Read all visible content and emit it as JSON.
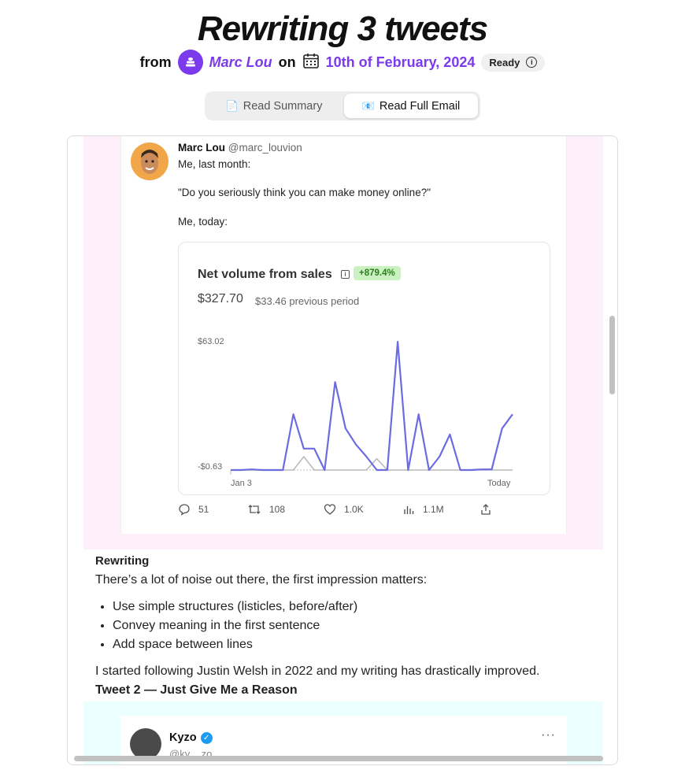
{
  "header": {
    "title": "Rewriting 3 tweets",
    "from_label": "from",
    "author": "Marc Lou",
    "on_label": "on",
    "date": "10th of February, 2024",
    "status": "Ready"
  },
  "tabs": [
    {
      "label": "Read Summary",
      "icon": "document-icon"
    },
    {
      "label": "Read Full Email",
      "icon": "email-icon"
    }
  ],
  "tweet1": {
    "name": "Marc Lou",
    "handle": "@marc_louvion",
    "line1": "Me, last month:",
    "line2": "\"Do you seriously think you can make money online?\"",
    "line3": "Me, today:",
    "stats": {
      "replies": "51",
      "retweets": "108",
      "likes": "1.0K",
      "views": "1.1M"
    }
  },
  "chart_data": {
    "type": "line",
    "title": "Net volume from sales",
    "change_badge": "+879.4%",
    "value": "$327.70",
    "previous": "$33.46 previous period",
    "y_max_label": "$63.02",
    "y_min_label": "-$0.63",
    "x_start_label": "Jan 3",
    "x_end_label": "Today",
    "ylim": [
      -0.63,
      63.02
    ],
    "series": [
      {
        "values": [
          -0.63,
          -0.63,
          -0.3,
          -0.63,
          -0.63,
          -0.63,
          27,
          10,
          10,
          -0.63,
          43,
          20,
          12,
          6,
          -0.63,
          -0.63,
          63,
          -0.63,
          27,
          -0.63,
          6,
          17,
          -0.63,
          -0.63,
          -0.3,
          -0.3,
          20,
          27
        ],
        "color": "#6c6ce0"
      },
      {
        "values": [
          -0.63,
          -0.63,
          -0.63,
          -0.63,
          -0.63,
          -0.63,
          -0.63,
          6,
          -0.63,
          -0.63,
          -0.63,
          -0.63,
          -0.63,
          -0.63,
          5,
          -0.63,
          -0.63,
          -0.63,
          -0.63,
          -0.63,
          -0.63,
          -0.63,
          -0.63,
          -0.63,
          -0.63,
          -0.63,
          -0.63,
          -0.63
        ],
        "color": "#b8b8b8"
      }
    ]
  },
  "body": {
    "heading": "Rewriting",
    "intro": "There’s a lot of noise out there, the first impression matters:",
    "bullets": [
      "Use simple structures (listicles, before/after)",
      "Convey meaning in the first sentence",
      "Add space between lines"
    ],
    "outro": "I started following Justin Welsh in 2022 and my writing has drastically improved.",
    "next_heading": "Tweet 2 — Just Give Me a Reason"
  },
  "tweet2": {
    "name": "Kyzo",
    "handle": "@ky__zo",
    "more": "···"
  }
}
